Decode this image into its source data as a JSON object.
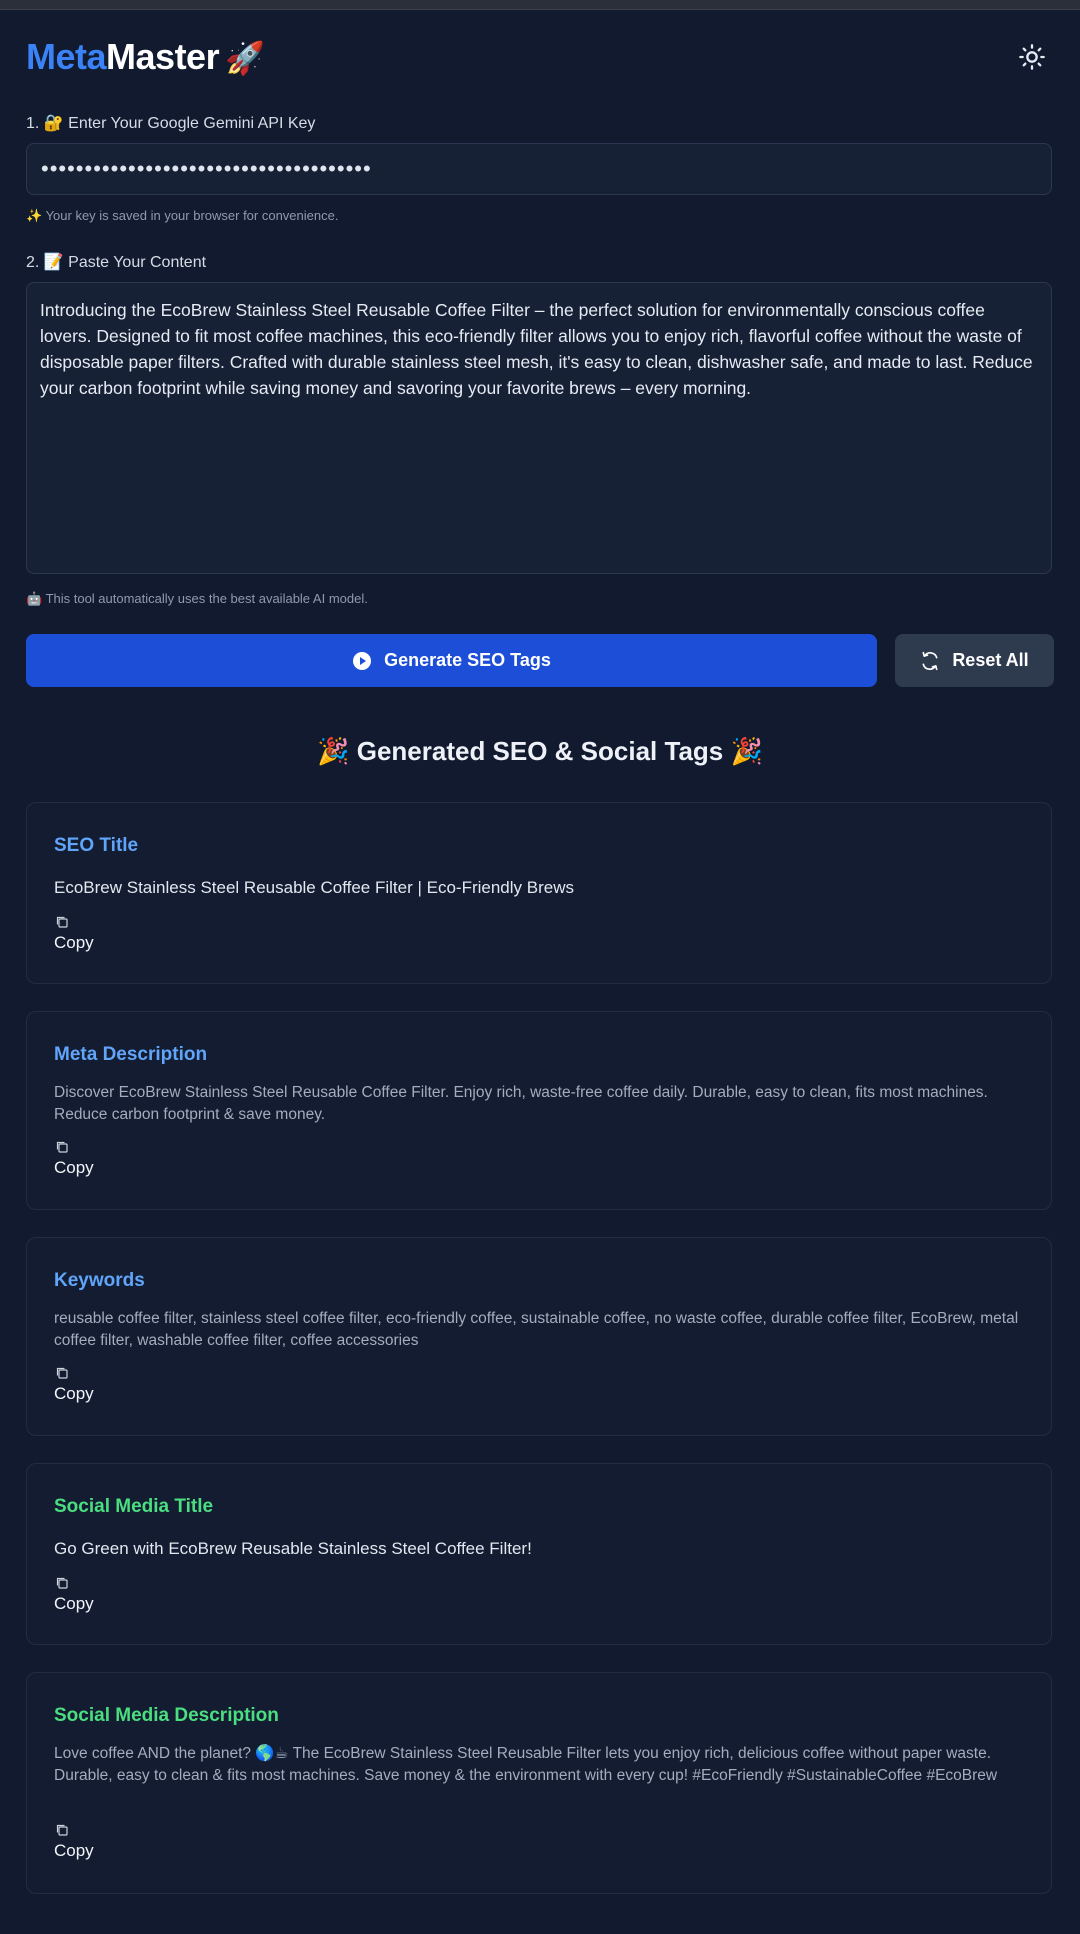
{
  "header": {
    "logo_part1": "Meta",
    "logo_part2": "Master",
    "logo_emoji": "🚀",
    "theme_icon": "sun-icon"
  },
  "api_key": {
    "label": "1. 🔐 Enter Your Google Gemini API Key",
    "value": "••••••••••••••••••••••••••••••••••••••",
    "hint": "✨ Your key is saved in your browser for convenience."
  },
  "content": {
    "label": "2. 📝 Paste Your Content",
    "value": "Introducing the EcoBrew Stainless Steel Reusable Coffee Filter – the perfect solution for environmentally conscious coffee lovers. Designed to fit most coffee machines, this eco-friendly filter allows you to enjoy rich, flavorful coffee without the waste of disposable paper filters. Crafted with durable stainless steel mesh, it's easy to clean, dishwasher safe, and made to last. Reduce your carbon footprint while saving money and savoring your favorite brews – every morning.",
    "hint": "🤖 This tool automatically uses the best available AI model."
  },
  "actions": {
    "generate_label": "Generate SEO Tags",
    "reset_label": "Reset All"
  },
  "results": {
    "title": "🎉 Generated SEO & Social Tags 🎉",
    "copy_label": "Copy",
    "cards": [
      {
        "title": "SEO Title",
        "text": "EcoBrew Stainless Steel Reusable Coffee Filter | Eco-Friendly Brews"
      },
      {
        "title": "Meta Description",
        "text": "Discover EcoBrew Stainless Steel Reusable Coffee Filter. Enjoy rich, waste-free coffee daily. Durable, easy to clean, fits most machines. Reduce carbon footprint & save money."
      },
      {
        "title": "Keywords",
        "text": "reusable coffee filter, stainless steel coffee filter, eco-friendly coffee, sustainable coffee, no waste coffee, durable coffee filter, EcoBrew, metal coffee filter, washable coffee filter, coffee accessories"
      },
      {
        "title": "Social Media Title",
        "text": "Go Green with EcoBrew Reusable Stainless Steel Coffee Filter!"
      },
      {
        "title": "Social Media Description",
        "text": "Love coffee AND the planet? 🌎☕ The EcoBrew Stainless Steel Reusable Filter lets you enjoy rich, delicious coffee without paper waste. Durable, easy to clean & fits most machines. Save money & the environment with every cup! #EcoFriendly #SustainableCoffee #EcoBrew"
      }
    ]
  },
  "colors": {
    "background": "#111a2e",
    "accent_blue": "#3b82f6",
    "title_blue": "#60a5fa",
    "title_green": "#4ade80",
    "primary_button": "#1d4ed8",
    "secondary_button": "#2e3b4e"
  }
}
